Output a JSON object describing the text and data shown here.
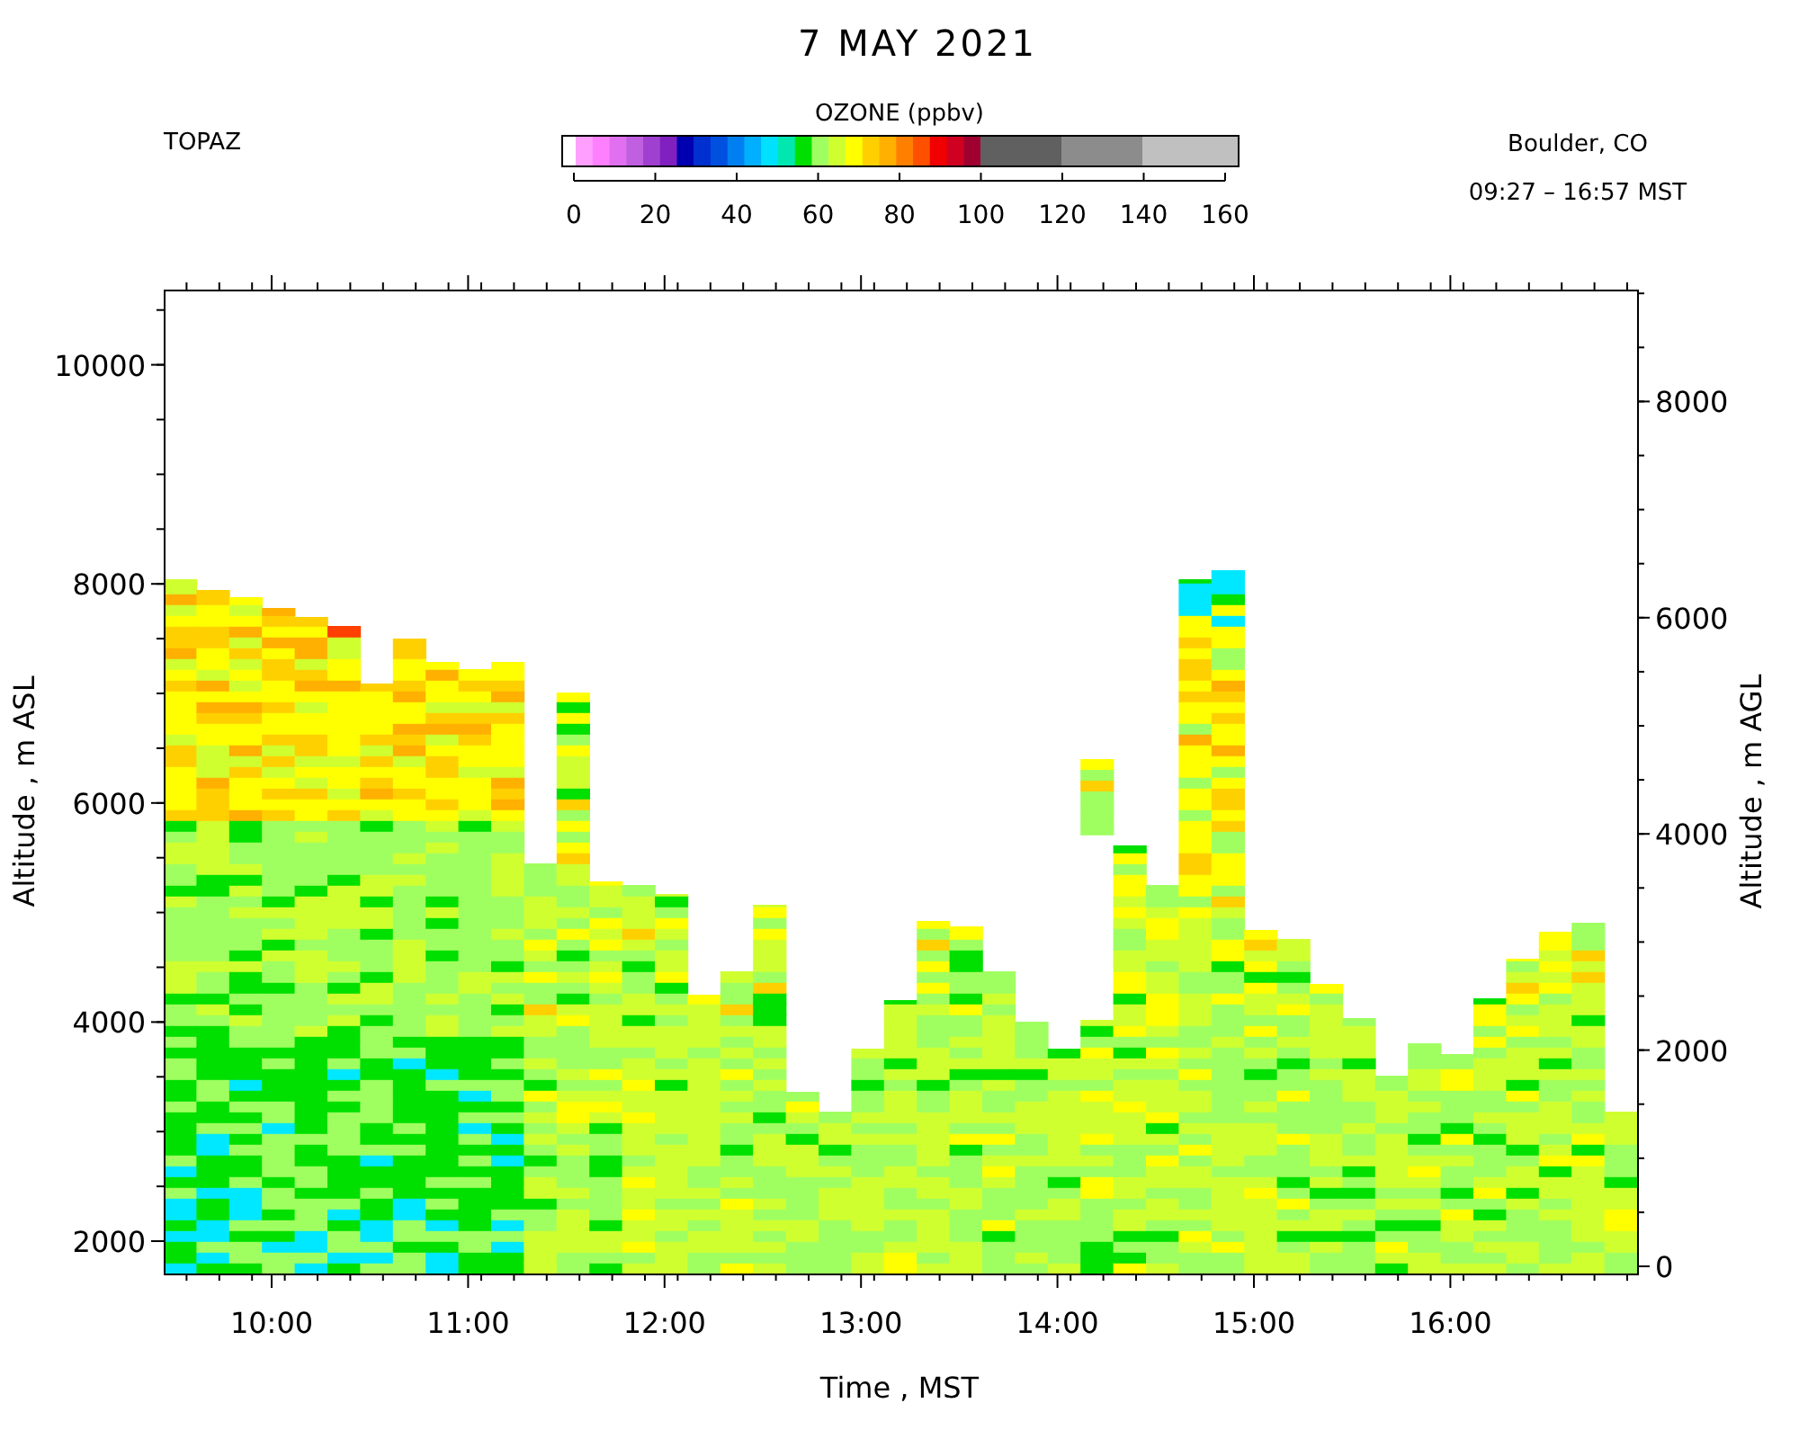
{
  "title": "7 MAY 2021",
  "instrument": "TOPAZ",
  "location": "Boulder, CO",
  "time_range": "09:27 – 16:57 MST",
  "colorbar": {
    "title": "OZONE (ppbv)",
    "tick_labels": [
      "0",
      "20",
      "40",
      "60",
      "80",
      "100",
      "120",
      "140",
      "160"
    ]
  },
  "y_axis_left": {
    "label": "Altitude , m ASL",
    "tick_labels": [
      "10000",
      "8000",
      "6000",
      "4000",
      "2000"
    ]
  },
  "y_axis_right": {
    "label": "Altitude , m AGL",
    "tick_labels": [
      "8000",
      "6000",
      "4000",
      "2000",
      "0"
    ]
  },
  "x_axis": {
    "label": "Time , MST",
    "tick_labels": [
      "10:00",
      "11:00",
      "12:00",
      "13:00",
      "14:00",
      "15:00",
      "16:00"
    ]
  }
}
